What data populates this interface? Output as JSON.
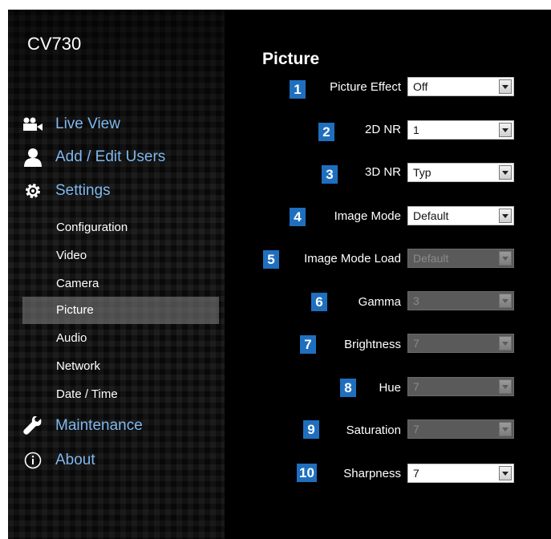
{
  "app_title": "CV730",
  "sidebar": {
    "main": [
      {
        "label": "Live View",
        "icon": "video-camera-icon"
      },
      {
        "label": "Add / Edit Users",
        "icon": "user-icon"
      },
      {
        "label": "Settings",
        "icon": "gear-icon"
      }
    ],
    "sub": [
      {
        "label": "Configuration"
      },
      {
        "label": "Video"
      },
      {
        "label": "Camera"
      },
      {
        "label": "Picture",
        "active": true
      },
      {
        "label": "Audio"
      },
      {
        "label": "Network"
      },
      {
        "label": "Date / Time"
      }
    ],
    "bottom": [
      {
        "label": "Maintenance",
        "icon": "wrench-icon"
      },
      {
        "label": "About",
        "icon": "info-icon"
      }
    ]
  },
  "content": {
    "title": "Picture",
    "fields": [
      {
        "num": "1",
        "label": "Picture Effect",
        "value": "Off",
        "enabled": true
      },
      {
        "num": "2",
        "label": "2D NR",
        "value": "1",
        "enabled": true
      },
      {
        "num": "3",
        "label": "3D NR",
        "value": "Typ",
        "enabled": true
      },
      {
        "num": "4",
        "label": "Image Mode",
        "value": "Default",
        "enabled": true
      },
      {
        "num": "5",
        "label": "Image Mode Load",
        "value": "Default",
        "enabled": false
      },
      {
        "num": "6",
        "label": "Gamma",
        "value": "3",
        "enabled": false
      },
      {
        "num": "7",
        "label": "Brightness",
        "value": "7",
        "enabled": false
      },
      {
        "num": "8",
        "label": "Hue",
        "value": "7",
        "enabled": false
      },
      {
        "num": "9",
        "label": "Saturation",
        "value": "7",
        "enabled": false
      },
      {
        "num": "10",
        "label": "Sharpness",
        "value": "7",
        "enabled": true
      }
    ]
  },
  "colors": {
    "accent": "#1f6fbf",
    "nav_link": "#7fb8ee",
    "active_bg": "#6e6e6e"
  }
}
